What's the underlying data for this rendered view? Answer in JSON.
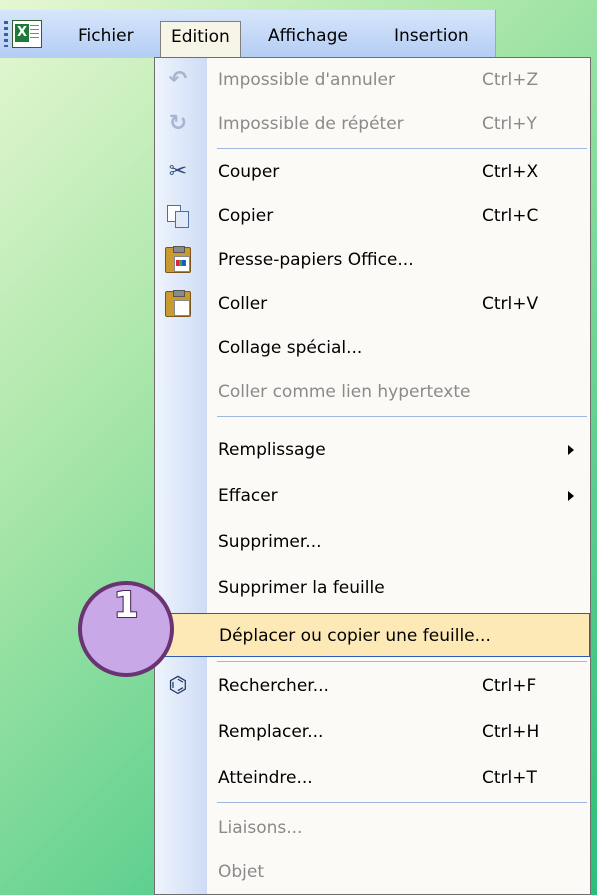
{
  "menubar": {
    "items": [
      {
        "label": "Fichier",
        "active": false
      },
      {
        "label": "Edition",
        "active": true
      },
      {
        "label": "Affichage",
        "active": false
      },
      {
        "label": "Insertion",
        "active": false
      }
    ]
  },
  "edit_menu": {
    "items": [
      {
        "label": "Impossible d'annuler",
        "shortcut": "Ctrl+Z",
        "disabled": true,
        "icon": "undo-icon"
      },
      {
        "label": "Impossible de répéter",
        "shortcut": "Ctrl+Y",
        "disabled": true,
        "icon": "redo-icon"
      },
      {
        "label": "Couper",
        "shortcut": "Ctrl+X",
        "disabled": false,
        "icon": "cut-icon"
      },
      {
        "label": "Copier",
        "shortcut": "Ctrl+C",
        "disabled": false,
        "icon": "copy-icon"
      },
      {
        "label": "Presse-papiers Office...",
        "shortcut": "",
        "disabled": false,
        "icon": "office-clipboard-icon"
      },
      {
        "label": "Coller",
        "shortcut": "Ctrl+V",
        "disabled": false,
        "icon": "paste-icon"
      },
      {
        "label": "Collage spécial...",
        "shortcut": "",
        "disabled": false
      },
      {
        "label": "Coller comme lien hypertexte",
        "shortcut": "",
        "disabled": true
      },
      {
        "label": "Remplissage",
        "shortcut": "",
        "disabled": false,
        "submenu": true
      },
      {
        "label": "Effacer",
        "shortcut": "",
        "disabled": false,
        "submenu": true
      },
      {
        "label": "Supprimer...",
        "shortcut": "",
        "disabled": false
      },
      {
        "label": "Supprimer la feuille",
        "shortcut": "",
        "disabled": false
      },
      {
        "label": "Déplacer ou copier une feuille...",
        "shortcut": "",
        "disabled": false,
        "highlighted": true
      },
      {
        "label": "Rechercher...",
        "shortcut": "Ctrl+F",
        "disabled": false,
        "icon": "binoculars-icon"
      },
      {
        "label": "Remplacer...",
        "shortcut": "Ctrl+H",
        "disabled": false
      },
      {
        "label": "Atteindre...",
        "shortcut": "Ctrl+T",
        "disabled": false
      },
      {
        "label": "Liaisons...",
        "shortcut": "",
        "disabled": true
      },
      {
        "label": "Objet",
        "shortcut": "",
        "disabled": true
      }
    ]
  },
  "callout": {
    "number": "1"
  },
  "colors": {
    "highlight": "#fde9b6",
    "highlight_border": "#2b5ab8",
    "callout_fill": "#c8a8e6",
    "callout_border": "#6a3473"
  }
}
